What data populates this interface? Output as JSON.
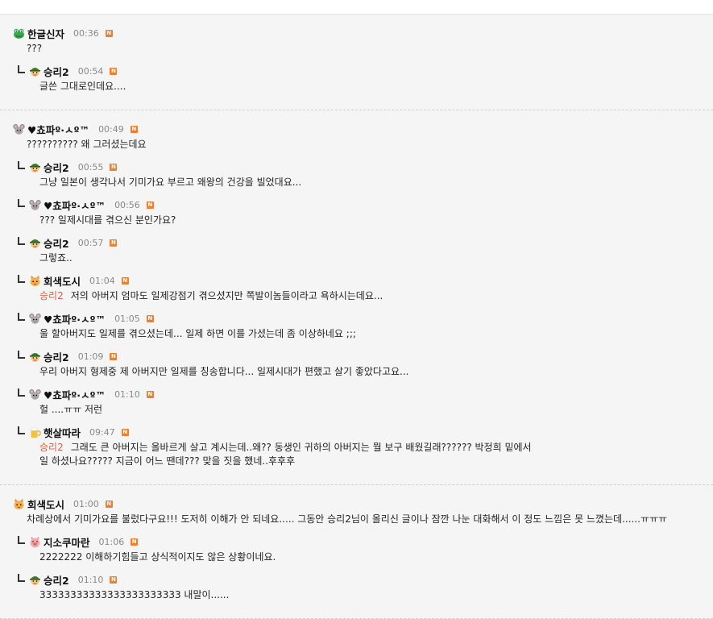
{
  "threads": [
    {
      "comments": [
        {
          "reply": false,
          "avatar": "frog",
          "name": "한글신자",
          "time": "00:36",
          "badge": "N",
          "text": "???"
        },
        {
          "reply": true,
          "avatar": "boy",
          "name": "승리2",
          "time": "00:54",
          "badge": "N",
          "text": "글쓴 그대로인데요...."
        }
      ]
    },
    {
      "comments": [
        {
          "reply": false,
          "avatar": "mouse",
          "name": "♥쵸파º·ㅅº™",
          "time": "00:49",
          "badge": "N",
          "text": "?????????? 왜 그러셨는데요"
        },
        {
          "reply": true,
          "avatar": "boy",
          "name": "승리2",
          "time": "00:55",
          "badge": "N",
          "text": "그냥 일본이 생각나서 기미가요 부르고 왜왕의 건강을 빌었대요..."
        },
        {
          "reply": true,
          "avatar": "mouse",
          "name": "♥쵸파º·ㅅº™",
          "time": "00:56",
          "badge": "N",
          "text": "??? 일제시대를 겪으신 분인가요?"
        },
        {
          "reply": true,
          "avatar": "boy",
          "name": "승리2",
          "time": "00:57",
          "badge": "N",
          "text": "그렇죠.."
        },
        {
          "reply": true,
          "avatar": "cat",
          "name": "회색도시",
          "time": "01:04",
          "badge": "N",
          "mention": "승리2",
          "text": "저의 아버지 엄마도 일제강점기 겪으셨지만 쪽발이놈들이라고 욕하시는데요..."
        },
        {
          "reply": true,
          "avatar": "mouse",
          "name": "♥쵸파º·ㅅº™",
          "time": "01:05",
          "badge": "N",
          "text": "울 할아버지도 일제를 겪으셨는데... 일제 하면 이를 가셨는데 좀 이상하네요 ;;;"
        },
        {
          "reply": true,
          "avatar": "boy",
          "name": "승리2",
          "time": "01:09",
          "badge": "N",
          "text": "우리 아버지 형제중 제 아버지만 일제를 칭송합니다... 일제시대가 편했고 살기 좋았다고요..."
        },
        {
          "reply": true,
          "avatar": "mouse",
          "name": "♥쵸파º·ㅅº™",
          "time": "01:10",
          "badge": "N",
          "text": "헐 ....ㅠㅠ 저런"
        },
        {
          "reply": true,
          "avatar": "beer",
          "name": "햇살따라",
          "time": "09:47",
          "badge": "N",
          "mention": "승리2",
          "text": "그래도 큰 아버지는 올바르게 살고 계시는데..왜?? 동생인 귀하의 아버지는 뭘 보구 배웠길래?????? 박정희 밑에서",
          "text2": "일 하셨나요????? 지금이 어느 땐데??? 맞을 짓을 했네..후후후",
          "tall": true
        }
      ]
    },
    {
      "comments": [
        {
          "reply": false,
          "avatar": "cat",
          "name": "회색도시",
          "time": "01:00",
          "badge": "N",
          "text": "차례상에서 기미가요를 불렀다구요!!! 도저히 이해가 안 되네요..... 그동안 승리2님이 올리신 글이나 잠깐 나눈 대화해서 이 정도 느낌은 못 느꼈는데......ㅠㅠㅠ"
        },
        {
          "reply": true,
          "avatar": "pig",
          "name": "지소쿠마란",
          "time": "01:06",
          "badge": "N",
          "text": "2222222 이해하기힘들고 상식적이지도 않은 상황이네요."
        },
        {
          "reply": true,
          "avatar": "boy",
          "name": "승리2",
          "time": "01:10",
          "badge": "N",
          "text": "33333333333333333333333 내말이......"
        }
      ]
    }
  ]
}
